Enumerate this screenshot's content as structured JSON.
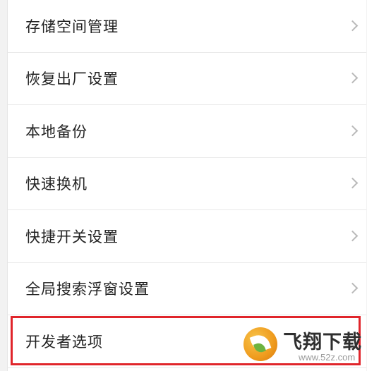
{
  "settings_list": {
    "items": [
      {
        "label": "存储空间管理"
      },
      {
        "label": "恢复出厂设置"
      },
      {
        "label": "本地备份"
      },
      {
        "label": "快速换机"
      },
      {
        "label": "快捷开关设置"
      },
      {
        "label": "全局搜索浮窗设置"
      },
      {
        "label": "开发者选项"
      }
    ]
  },
  "highlight": {
    "color": "#e0252b",
    "target_item": "开发者选项"
  },
  "watermark": {
    "title": "飞翔下载",
    "url": "www.52z.com"
  }
}
